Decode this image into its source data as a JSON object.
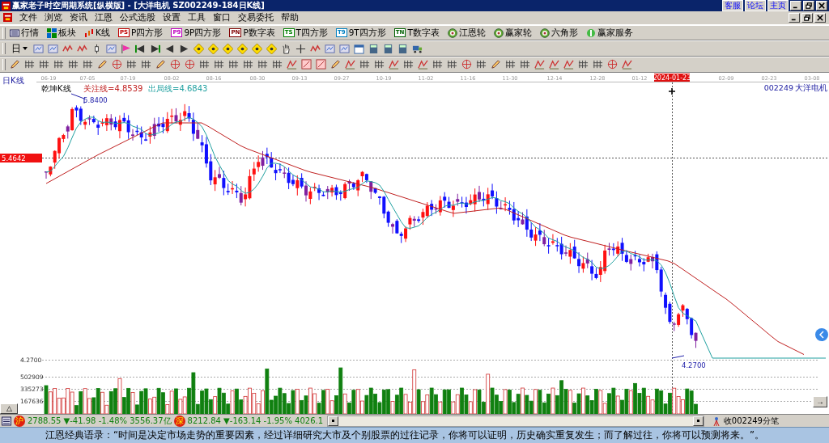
{
  "window": {
    "title": "赢家老子时空周期系统[纵横版] - [大洋电机   SZ002249-184日K线]",
    "links": [
      "客服",
      "论坛",
      "主页"
    ]
  },
  "menu": [
    "文件",
    "浏览",
    "资讯",
    "江恩",
    "公式选股",
    "设置",
    "工具",
    "窗口",
    "交易委托",
    "帮助"
  ],
  "toolbar": [
    {
      "kind": "icon",
      "label": "行情"
    },
    {
      "kind": "icon",
      "label": "板块"
    },
    {
      "kind": "icon",
      "label": "K线"
    },
    {
      "kind": "badge",
      "badge": "PS",
      "label": "P四方形",
      "color": "#c00000"
    },
    {
      "kind": "badge",
      "badge": "P9",
      "label": "9P四方形",
      "color": "#c000c0"
    },
    {
      "kind": "badge",
      "badge": "PN",
      "label": "P数字表",
      "color": "#800000"
    },
    {
      "kind": "badge",
      "badge": "TS",
      "label": "T四方形",
      "color": "#008000"
    },
    {
      "kind": "badge",
      "badge": "T9",
      "label": "9T四方形",
      "color": "#0080c0"
    },
    {
      "kind": "badge",
      "badge": "TN",
      "label": "T数字表",
      "color": "#006000"
    },
    {
      "kind": "icon",
      "label": "江恩轮"
    },
    {
      "kind": "icon",
      "label": "赢家轮"
    },
    {
      "kind": "icon",
      "label": "六角形"
    },
    {
      "kind": "icon",
      "label": "赢家服务"
    }
  ],
  "period_dropdown": "日",
  "chart": {
    "period_label": "日K线",
    "indicator": "乾坤K线",
    "dates": [
      {
        "label": "06-19",
        "selected": false
      },
      {
        "label": "07-05",
        "selected": false
      },
      {
        "label": "07-19",
        "selected": false
      },
      {
        "label": "08-02",
        "selected": false
      },
      {
        "label": "08-16",
        "selected": false
      },
      {
        "label": "08-30",
        "selected": false
      },
      {
        "label": "09-13",
        "selected": false
      },
      {
        "label": "09-27",
        "selected": false
      },
      {
        "label": "10-19",
        "selected": false
      },
      {
        "label": "11-02",
        "selected": false
      },
      {
        "label": "11-16",
        "selected": false
      },
      {
        "label": "11-30",
        "selected": false
      },
      {
        "label": "12-14",
        "selected": false
      },
      {
        "label": "12-28",
        "selected": false
      },
      {
        "label": "01-12",
        "selected": false
      },
      {
        "label": "2024-01-23",
        "selected": true
      },
      {
        "label": "02-09",
        "selected": false
      },
      {
        "label": "02-23",
        "selected": false
      },
      {
        "label": "03-08",
        "selected": false
      }
    ],
    "lines": [
      {
        "label": "关注线=4.8539",
        "color": "#c02020"
      },
      {
        "label": "出局线=4.6843",
        "color": "#20a0a0"
      }
    ],
    "stock_code": "002249",
    "stock_name": "大洋电机",
    "high_label": "5.8400",
    "current_price": "5.4642",
    "low_label": "4.2700"
  },
  "volume": {
    "axis_labels": [
      "4.2700",
      "502909",
      "335273",
      "167636"
    ]
  },
  "collapse_button": "△",
  "scroll_right_button": "→",
  "status": {
    "sh_badge": "沪",
    "sh_quote": "2788.55 ▼-41.98 -1.48% 3556.37亿",
    "sz_badge": "深",
    "sz_quote": "8212.84 ▼-163.14 -1.95% 4026.1",
    "feed": "收002249分笔"
  },
  "quote": "江恩经典语录：“时间是决定市场走势的重要因素，经过详细研究大市及个别股票的过往记录，你将可以证明，历史确实重复发生；而了解过往，你将可以预测将来。”。"
}
